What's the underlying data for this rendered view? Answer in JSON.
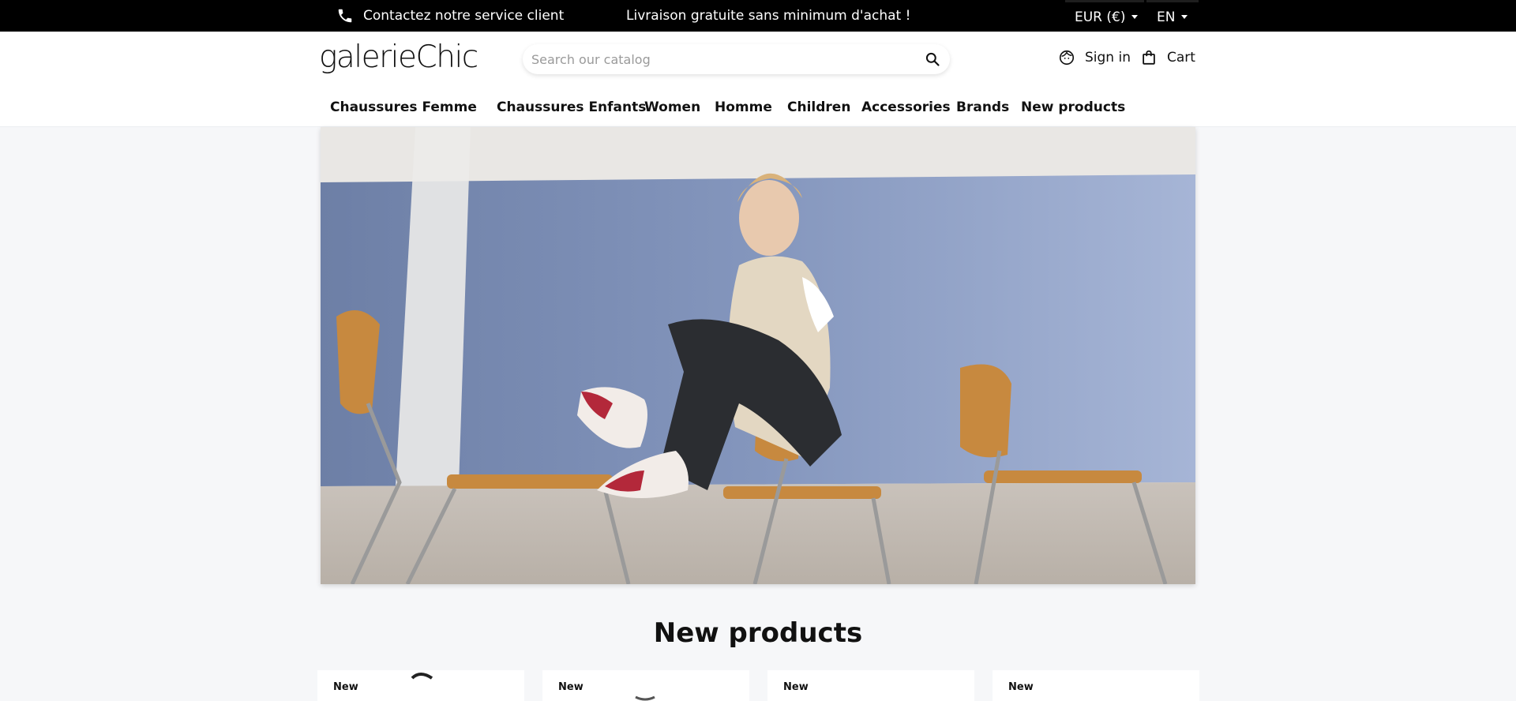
{
  "topbar": {
    "contact_label": "Contactez notre service client",
    "shipping_message": "Livraison gratuite sans minimum d'achat !",
    "currency_label": "EUR (€)",
    "language_label": "EN"
  },
  "header": {
    "logo_text": "galerieChic",
    "search": {
      "placeholder": "Search our catalog",
      "value": ""
    },
    "signin_label": "Sign in",
    "cart_label": "Cart"
  },
  "nav": {
    "items": [
      {
        "label": "Chaussures Femme"
      },
      {
        "label": "Chaussures Enfants"
      },
      {
        "label": "Women"
      },
      {
        "label": "Homme"
      },
      {
        "label": "Children"
      },
      {
        "label": "Accessories"
      },
      {
        "label": "Brands"
      },
      {
        "label": "New products"
      }
    ]
  },
  "section": {
    "title": "New products"
  },
  "products": [
    {
      "badge": "New"
    },
    {
      "badge": "New"
    },
    {
      "badge": "New"
    },
    {
      "badge": "New"
    }
  ],
  "colors": {
    "topbar_bg": "#000000",
    "page_bg": "#f6f7f9",
    "text": "#111111"
  }
}
